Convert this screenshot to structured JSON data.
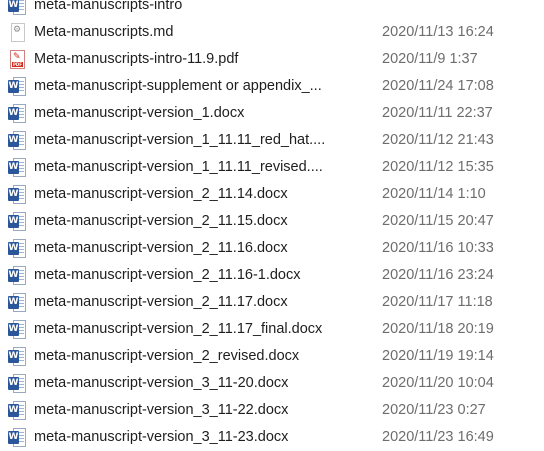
{
  "files": [
    {
      "name": "meta-manuscripts-intro",
      "date": "",
      "type": "word"
    },
    {
      "name": "Meta-manuscripts.md",
      "date": "2020/11/13 16:24",
      "type": "md"
    },
    {
      "name": "Meta-manuscripts-intro-11.9.pdf",
      "date": "2020/11/9 1:37",
      "type": "pdf"
    },
    {
      "name": "meta-manuscript-supplement or appendix_...",
      "date": "2020/11/24 17:08",
      "type": "word"
    },
    {
      "name": "meta-manuscript-version_1.docx",
      "date": "2020/11/11 22:37",
      "type": "word"
    },
    {
      "name": "meta-manuscript-version_1_11.11_red_hat....",
      "date": "2020/11/12 21:43",
      "type": "word"
    },
    {
      "name": "meta-manuscript-version_1_11.11_revised....",
      "date": "2020/11/12 15:35",
      "type": "word"
    },
    {
      "name": "meta-manuscript-version_2_11.14.docx",
      "date": "2020/11/14 1:10",
      "type": "word"
    },
    {
      "name": "meta-manuscript-version_2_11.15.docx",
      "date": "2020/11/15 20:47",
      "type": "word"
    },
    {
      "name": "meta-manuscript-version_2_11.16.docx",
      "date": "2020/11/16 10:33",
      "type": "word"
    },
    {
      "name": "meta-manuscript-version_2_11.16-1.docx",
      "date": "2020/11/16 23:24",
      "type": "word"
    },
    {
      "name": "meta-manuscript-version_2_11.17.docx",
      "date": "2020/11/17 11:18",
      "type": "word"
    },
    {
      "name": "meta-manuscript-version_2_11.17_final.docx",
      "date": "2020/11/18 20:19",
      "type": "word"
    },
    {
      "name": "meta-manuscript-version_2_revised.docx",
      "date": "2020/11/19 19:14",
      "type": "word"
    },
    {
      "name": "meta-manuscript-version_3_11-20.docx",
      "date": "2020/11/20 10:04",
      "type": "word"
    },
    {
      "name": "meta-manuscript-version_3_11-22.docx",
      "date": "2020/11/23 0:27",
      "type": "word"
    },
    {
      "name": "meta-manuscript-version_3_11-23.docx",
      "date": "2020/11/23 16:49",
      "type": "word"
    }
  ],
  "icons": {
    "word_letter": "W",
    "pdf_letter": "PDF",
    "pdf_mark": "✎",
    "md_mark": "⚙"
  },
  "colors": {
    "word_blue": "#2b579a",
    "pdf_red": "#d52b1e",
    "date_gray": "#6d6d6d"
  }
}
